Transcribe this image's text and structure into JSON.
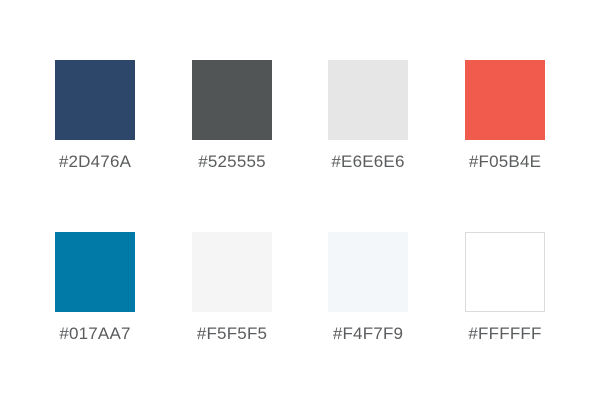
{
  "swatches": [
    {
      "label": "#2D476A",
      "color": "#2D476A"
    },
    {
      "label": "#525555",
      "color": "#525555"
    },
    {
      "label": "#E6E6E6",
      "color": "#E6E6E6"
    },
    {
      "label": "#F05B4E",
      "color": "#F05B4E"
    },
    {
      "label": "#017AA7",
      "color": "#017AA7"
    },
    {
      "label": "#F5F5F5",
      "color": "#F5F5F5"
    },
    {
      "label": "#F4F7F9",
      "color": "#F4F7F9"
    },
    {
      "label": "#FFFFFF",
      "color": "#FFFFFF"
    }
  ]
}
